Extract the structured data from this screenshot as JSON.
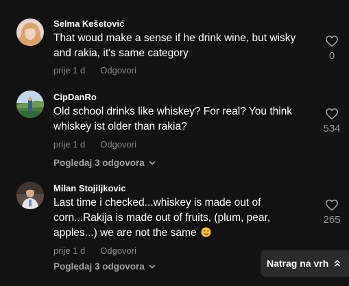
{
  "comments": [
    {
      "author": "Selma Kešetović",
      "text": "That woud make a sense if he drink wine, but wisky and rakia, it's same category",
      "time": "prije 1 d",
      "reply_label": "Odgovori",
      "likes": "0",
      "avatar_icon": "avatar-woman-photo"
    },
    {
      "author": "CipDanRo",
      "text": "Old school drinks like whiskey? For real? You think whiskey ist older than rakia?",
      "time": "prije 1 d",
      "reply_label": "Odgovori",
      "likes": "534",
      "view_replies": "Pogledaj 3 odgovora",
      "avatar_icon": "avatar-landscape-photo"
    },
    {
      "author": "Milan Stojiljkovic",
      "text": "Last time i checked...whiskey is made out of corn...Rakija is made out of fruits, (plum, pear, apples...) we are not the same",
      "emoji": "winking-face-with-tongue",
      "time": "prije 1 d",
      "reply_label": "Odgovori",
      "likes": "265",
      "view_replies": "Pogledaj 3 odgovora",
      "avatar_icon": "avatar-man-photo"
    }
  ],
  "back_to_top": {
    "label": "Natrag na vrh",
    "icon": "double-chevron-up-icon"
  },
  "colors": {
    "background": "#121212",
    "text": "#ffffff",
    "muted": "#8a8a8a",
    "button_bg": "#2b2b2b"
  }
}
